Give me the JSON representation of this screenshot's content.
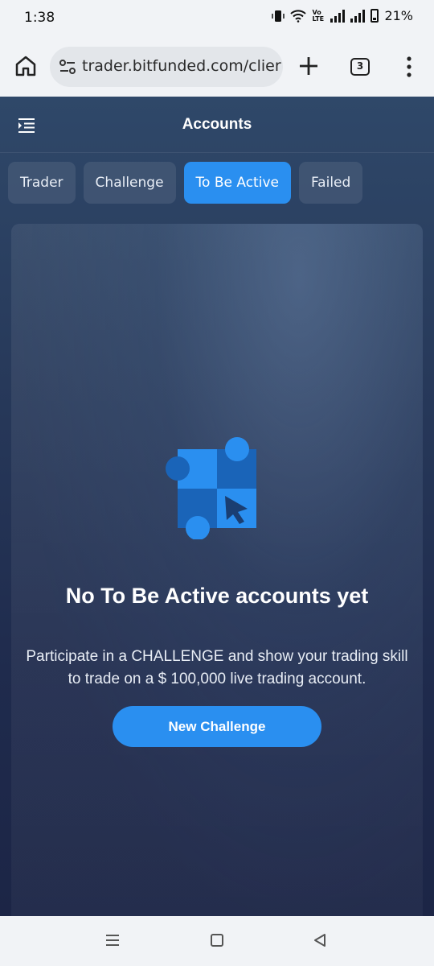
{
  "status_bar": {
    "time": "1:38",
    "battery_percent": "21%",
    "network_label": "Vo LTE"
  },
  "browser": {
    "url": "trader.bitfunded.com/clier",
    "tab_count": "3"
  },
  "app": {
    "title": "Accounts",
    "tabs": [
      {
        "label": "Trader",
        "active": false
      },
      {
        "label": "Challenge",
        "active": false
      },
      {
        "label": "To Be Active",
        "active": true
      },
      {
        "label": "Failed",
        "active": false
      }
    ],
    "empty_state": {
      "title": "No To Be Active accounts yet",
      "description_line1": "Participate in a CHALLENGE and show your trading skill",
      "description_line2": "to trade on a $ 100,000 live trading account.",
      "button_label": "New Challenge"
    }
  },
  "colors": {
    "accent": "#2a8ff0",
    "background_top": "#2f4869",
    "background_bottom": "#1c2546"
  },
  "icons": {
    "home": "home-icon",
    "site_settings": "site-settings-icon",
    "new_tab": "plus-icon",
    "menu": "more-vert-icon",
    "sidebar_toggle": "menu-icon",
    "empty_state": "puzzle-cursor-icon"
  }
}
